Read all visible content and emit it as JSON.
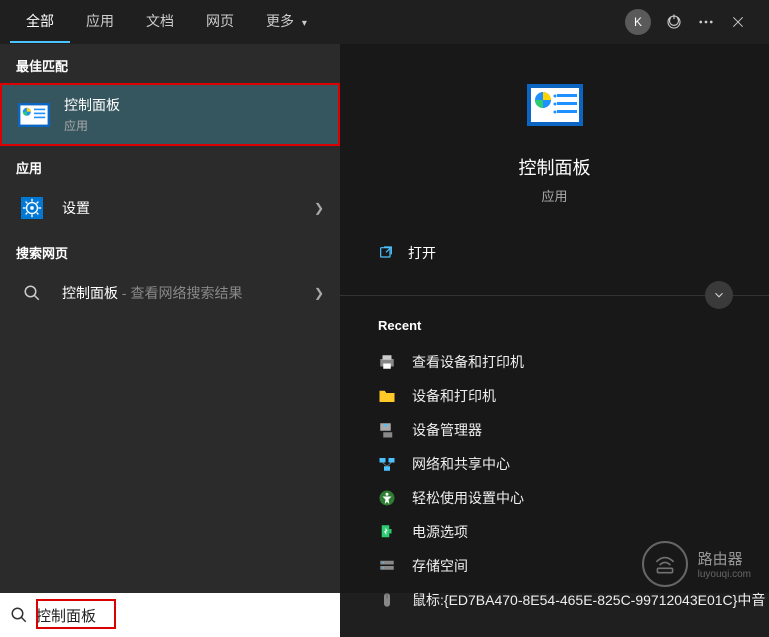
{
  "header": {
    "tabs": [
      "全部",
      "应用",
      "文档",
      "网页",
      "更多"
    ],
    "avatar_letter": "K"
  },
  "left": {
    "best_match_header": "最佳匹配",
    "best_match": {
      "title": "控制面板",
      "sub": "应用"
    },
    "apps_header": "应用",
    "apps": [
      {
        "title": "设置"
      }
    ],
    "web_header": "搜索网页",
    "web": [
      {
        "title": "控制面板",
        "suffix": " - 查看网络搜索结果"
      }
    ]
  },
  "right": {
    "hero_title": "控制面板",
    "hero_sub": "应用",
    "open_label": "打开",
    "recent_header": "Recent",
    "recent": [
      "查看设备和打印机",
      "设备和打印机",
      "设备管理器",
      "网络和共享中心",
      "轻松使用设置中心",
      "电源选项",
      "存储空间",
      "鼠标:{ED7BA470-8E54-465E-825C-99712043E01C}中音"
    ]
  },
  "search": {
    "value": "控制面板"
  },
  "watermark": {
    "text": "路由器",
    "sub": "luyouqi.com"
  }
}
